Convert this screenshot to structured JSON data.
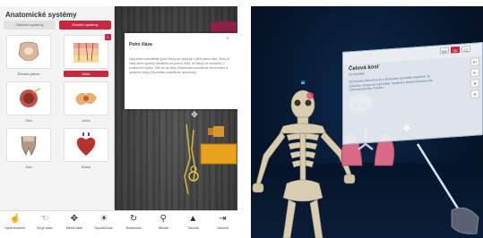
{
  "left_app": {
    "title": "Anatomické systémy",
    "tabs": [
      {
        "label": "Základní systémy",
        "active": false
      },
      {
        "label": "Detailní systémy",
        "active": true
      }
    ],
    "systems": [
      {
        "label": "Ženská pánev",
        "icon": "pelvis-icon",
        "selected": false
      },
      {
        "label": "Kůže",
        "icon": "skin-layers-icon",
        "selected": true,
        "badge": "1"
      },
      {
        "label": "Oko",
        "icon": "eye-icon",
        "selected": false
      },
      {
        "label": "Ucho",
        "icon": "ear-icon",
        "selected": false
      },
      {
        "label": "Zub",
        "icon": "tooth-icon",
        "selected": false
      },
      {
        "label": "Srdce",
        "icon": "heart-icon",
        "selected": false
      }
    ],
    "info_card": {
      "title": "Potní žláza",
      "text": "Glandulae sudoriferae (potní žlázy) se vyskytují v kůži celého těla. Žlázy (a žlázy které vyúsťují kanálkem na povrch kůže, do žlázy) se nacházejí v podkožním vazivu. Dělí se na žlázy (Glandulae sudoriferae merocrinae) a apokrinní žlázy (Glandulae sudoriferae apocrinae)."
    },
    "toolbar": [
      {
        "label": "Výběr/kotvení",
        "icon": "select-hand-icon"
      },
      {
        "label": "Skrýt části",
        "icon": "hide-parts-icon"
      },
      {
        "label": "Měnit části",
        "icon": "move-parts-icon"
      },
      {
        "label": "Spustit/Zast.",
        "icon": "lightbulb-icon"
      },
      {
        "label": "Resetovat",
        "icon": "reset-icon"
      },
      {
        "label": "Hledat",
        "icon": "search-icon"
      },
      {
        "label": "Tutorial",
        "icon": "graduation-cap-icon"
      },
      {
        "label": "Ukončit",
        "icon": "exit-icon"
      }
    ],
    "colors": {
      "accent": "#c8283f"
    }
  },
  "vr_app": {
    "languages": [
      {
        "label": "EN",
        "active": false
      },
      {
        "label": "SK",
        "active": true
      },
      {
        "label": "CZ",
        "active": false
      }
    ],
    "panel": {
      "title": "Čelová kosť",
      "subtitle": "Os frontale",
      "text": "Os frontale (čelová kosť) v dospelosti spravidla nepárová. Je súčasťou mozgovej časti lebky. Spojená s temennými kosťami, čuchovou kosťou, Pankos..."
    },
    "side_buttons": [
      "A+",
      "A-",
      "zoom-in-icon",
      "zoom-out-icon"
    ]
  }
}
